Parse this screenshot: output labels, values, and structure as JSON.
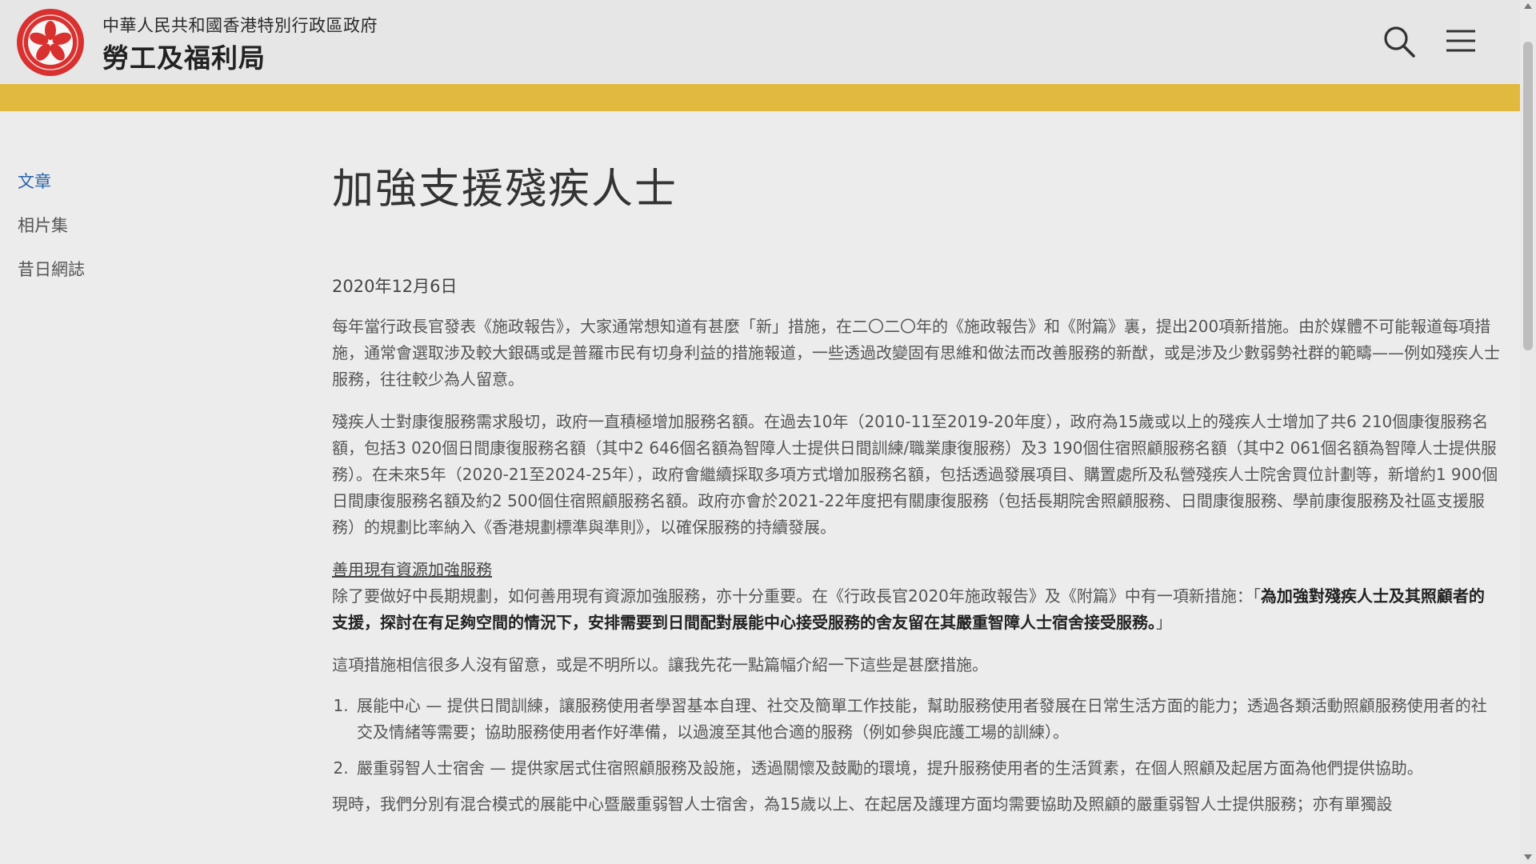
{
  "header": {
    "gov_name": "中華人民共和國香港特別行政區政府",
    "bureau_name": "勞工及福利局",
    "accent_color": "#e0b93e"
  },
  "sidebar": {
    "items": [
      {
        "label": "文章",
        "active": true
      },
      {
        "label": "相片集",
        "active": false
      },
      {
        "label": "昔日網誌",
        "active": false
      }
    ]
  },
  "article": {
    "title": "加強支援殘疾人士",
    "date": "2020年12月6日",
    "para1": "每年當行政長官發表《施政報告》，大家通常想知道有甚麼「新」措施，在二〇二〇年的《施政報告》和《附篇》裏，提出200項新措施。由於媒體不可能報道每項措施，通常會選取涉及較大銀碼或是普羅市民有切身利益的措施報道，一些透過改變固有思維和做法而改善服務的新猷，或是涉及少數弱勢社群的範疇——例如殘疾人士服務，往往較少為人留意。",
    "para2": "殘疾人士對康復服務需求殷切，政府一直積極增加服務名額。在過去10年（2010-11至2019-20年度），政府為15歲或以上的殘疾人士增加了共6 210個康復服務名額，包括3 020個日間康復服務名額（其中2 646個名額為智障人士提供日間訓練/職業康復服務）及3 190個住宿照顧服務名額（其中2 061個名額為智障人士提供服務）。在未來5年（2020-21至2024-25年），政府會繼續採取多項方式增加服務名額，包括透過發展項目、購置處所及私營殘疾人士院舍買位計劃等，新增約1 900個日間康復服務名額及約2 500個住宿照顧服務名額。政府亦會於2021-22年度把有關康復服務（包括長期院舍照顧服務、日間康復服務、學前康復服務及社區支援服務）的規劃比率納入《香港規劃標準與準則》，以確保服務的持續發展。",
    "subheading": "善用現有資源加強服務",
    "para3_plain": "除了要做好中長期規劃，如何善用現有資源加強服務，亦十分重要。在《行政長官2020年施政報告》及《附篇》中有一項新措施：「",
    "para3_bold": "為加強對殘疾人士及其照顧者的支援，探討在有足夠空間的情況下，安排需要到日間配對展能中心接受服務的舍友留在其嚴重智障人士宿舍接受服務。",
    "para3_end": "」",
    "para4": "這項措施相信很多人沒有留意，或是不明所以。讓我先花一點篇幅介紹一下這些是甚麼措施。",
    "list": [
      "展能中心 — 提供日間訓練，讓服務使用者學習基本自理、社交及簡單工作技能，幫助服務使用者發展在日常生活方面的能力；透過各類活動照顧服務使用者的社交及情緒等需要；協助服務使用者作好準備，以過渡至其他合適的服務（例如參與庇護工場的訓練）。",
      "嚴重弱智人士宿舍 — 提供家居式住宿照顧服務及設施，透過關懷及鼓勵的環境，提升服務使用者的生活質素，在個人照顧及起居方面為他們提供協助。"
    ],
    "para5": "現時，我們分別有混合模式的展能中心暨嚴重弱智人士宿舍，為15歲以上、在起居及護理方面均需要協助及照顧的嚴重弱智人士提供服務；亦有單獨設"
  }
}
